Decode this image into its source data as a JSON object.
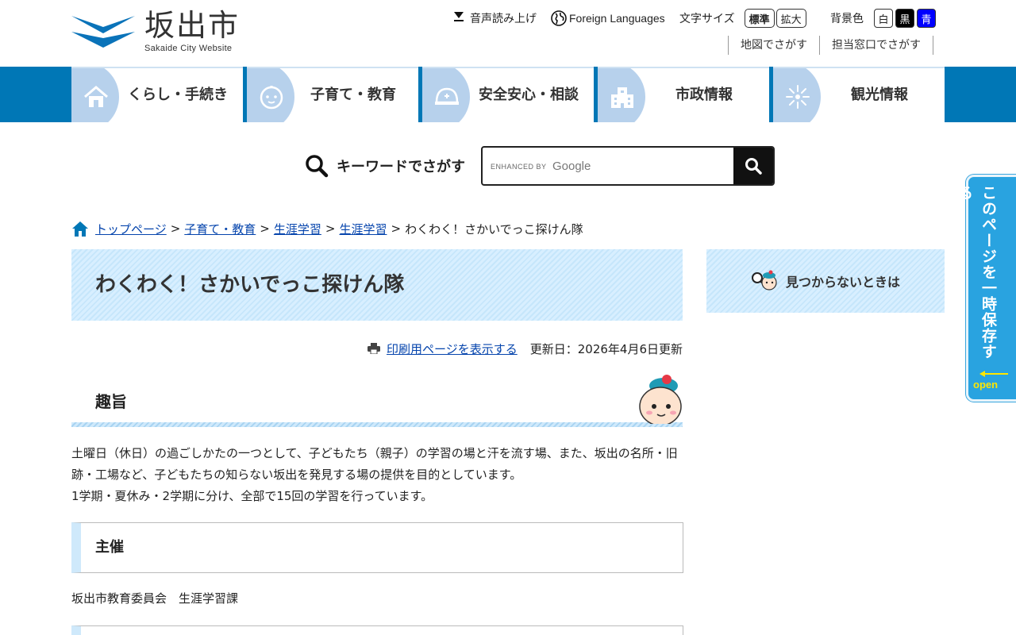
{
  "header": {
    "logo_ja": "坂出市",
    "logo_en": "Sakaide City Website",
    "voice_label": "音声読み上げ",
    "foreign_label": "Foreign Languages",
    "fontsize_label": "文字サイズ",
    "fontsize_standard": "標準",
    "fontsize_large": "拡大",
    "bgcolor_label": "背景色",
    "bg_white": "白",
    "bg_black": "黒",
    "bg_blue": "青",
    "map_link": "地図でさがす",
    "desk_link": "担当窓口でさがす"
  },
  "gnav": {
    "items": [
      {
        "label": "くらし・手続き",
        "icon": "house-icon"
      },
      {
        "label": "子育て・教育",
        "icon": "baby-icon"
      },
      {
        "label": "安全安心・相談",
        "icon": "helmet-icon"
      },
      {
        "label": "市政情報",
        "icon": "building-icon"
      },
      {
        "label": "観光情報",
        "icon": "fireworks-icon"
      }
    ]
  },
  "search": {
    "label": "キーワードでさがす",
    "brand_enhanced": "ENHANCED BY",
    "brand_google": "Google",
    "value": ""
  },
  "breadcrumb": {
    "items": [
      "トップページ",
      "子育て・教育",
      "生涯学習",
      "生涯学習"
    ],
    "current": "わくわく！さかいでっこ探けん隊",
    "sep": ">"
  },
  "page": {
    "title": "わくわく！さかいでっこ探けん隊",
    "print_link": "印刷用ページを表示する",
    "updated": "更新日：2026年4月6日更新",
    "section1_heading": "趣旨",
    "section1_p1": "土曜日（休日）の過ごしかたの一つとして、子どもたち（親子）の学習の場と汗を流す場、また、坂出の名所・旧跡・工場など、子どもたちの知らない坂出を発見する場の提供を目的としています。",
    "section1_p2": "1学期・夏休み・2学期に分け、全部で15回の学習を行っています。",
    "section2_heading": "主催",
    "section2_text": "坂出市教育委員会　生涯学習課"
  },
  "side": {
    "notfound_label": "見つからないときは"
  },
  "save_tab": {
    "label": "このページを一時保存する",
    "open": "open"
  },
  "colors": {
    "nav_blue": "#0077b6",
    "light_blue": "#cfe9fb",
    "tab_blue": "#29a3e0"
  }
}
